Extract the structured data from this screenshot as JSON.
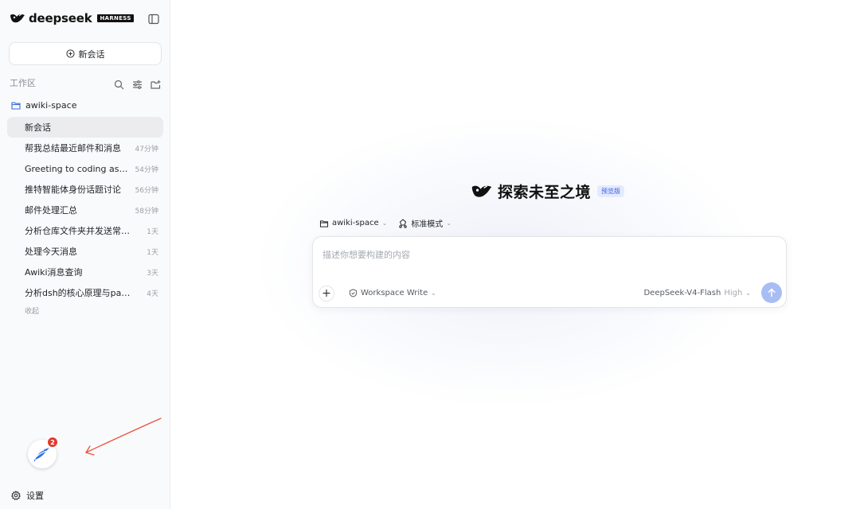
{
  "brand": {
    "name": "deepseek",
    "tag": "HARNESS"
  },
  "sidebar": {
    "new_chat_label": "新会话",
    "workspace_label": "工作区",
    "folder_name": "awiki-space",
    "chats": [
      {
        "title": "新会话",
        "time": "",
        "active": true
      },
      {
        "title": "帮我总结最近邮件和消息",
        "time": "47分钟"
      },
      {
        "title": "Greeting to coding assist...",
        "time": "54分钟"
      },
      {
        "title": "推特智能体身份话题讨论",
        "time": "56分钟"
      },
      {
        "title": "邮件处理汇总",
        "time": "58分钟"
      },
      {
        "title": "分析仓库文件夹并发送常高伟",
        "time": "1天"
      },
      {
        "title": "处理今天消息",
        "time": "1天"
      },
      {
        "title": "Awiki消息查询",
        "time": "3天"
      },
      {
        "title": "分析dsh的核心原理与paper",
        "time": "4天"
      }
    ],
    "collapse_label": "收起",
    "notification_count": "2",
    "settings_label": "设置"
  },
  "main": {
    "hero_title": "探索未至之境",
    "hero_badge": "预览版",
    "workspace_selector": "awiki-space",
    "mode_selector": "标准模式",
    "composer": {
      "placeholder": "描述你想要构建的内容",
      "value": "",
      "permission": "Workspace Write",
      "model": "DeepSeek-V4-Flash",
      "level": "High"
    }
  },
  "colors": {
    "accent": "#3b5bdb",
    "send_button": "#a9bdf5",
    "badge_red": "#e03a2f",
    "annotation_arrow": "#e8533b"
  }
}
